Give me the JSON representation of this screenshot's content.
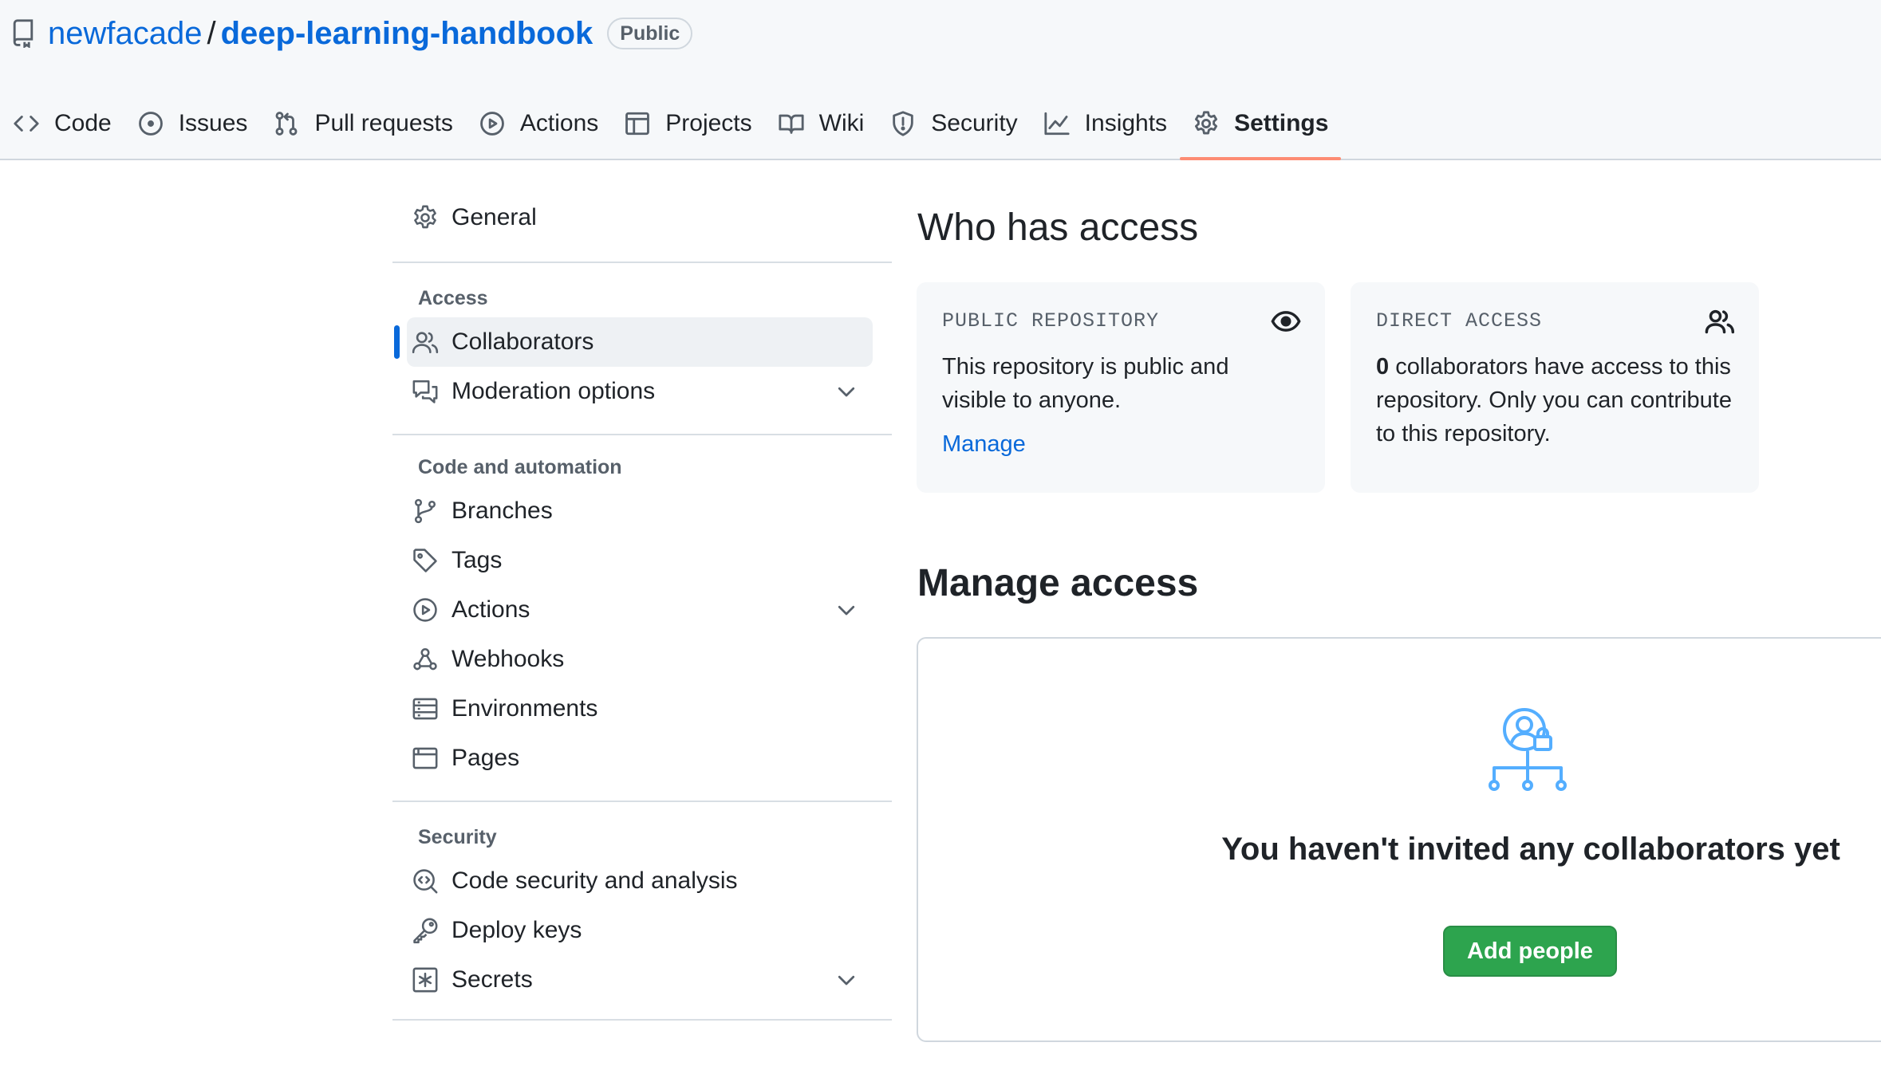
{
  "repo": {
    "owner": "newfacade",
    "separator": "/",
    "name": "deep-learning-handbook",
    "visibility": "Public"
  },
  "tabs": [
    {
      "label": "Code",
      "icon": "code-icon"
    },
    {
      "label": "Issues",
      "icon": "issue-icon"
    },
    {
      "label": "Pull requests",
      "icon": "pull-request-icon"
    },
    {
      "label": "Actions",
      "icon": "play-icon"
    },
    {
      "label": "Projects",
      "icon": "table-icon"
    },
    {
      "label": "Wiki",
      "icon": "book-icon"
    },
    {
      "label": "Security",
      "icon": "shield-icon"
    },
    {
      "label": "Insights",
      "icon": "graph-icon"
    },
    {
      "label": "Settings",
      "icon": "gear-icon",
      "active": true
    }
  ],
  "sidebar": {
    "general": "General",
    "access_label": "Access",
    "collaborators": "Collaborators",
    "moderation": "Moderation options",
    "code_label": "Code and automation",
    "branches": "Branches",
    "tags": "Tags",
    "actions": "Actions",
    "webhooks": "Webhooks",
    "environments": "Environments",
    "pages": "Pages",
    "security_label": "Security",
    "code_security": "Code security and analysis",
    "deploy_keys": "Deploy keys",
    "secrets": "Secrets"
  },
  "who_has_access": {
    "title": "Who has access",
    "public_card": {
      "kicker": "PUBLIC REPOSITORY",
      "text": "This repository is public and visible to anyone.",
      "link": "Manage"
    },
    "direct_card": {
      "kicker": "DIRECT ACCESS",
      "count": "0",
      "text": " collaborators have access to this repository. Only you can contribute to this repository."
    }
  },
  "manage_access": {
    "title": "Manage access",
    "empty_title": "You haven't invited any collaborators yet",
    "button": "Add people"
  },
  "colors": {
    "link": "#0969da",
    "active_tab_underline": "#fd8c73",
    "primary_button": "#2da44e",
    "illustration": "#54aeff"
  }
}
